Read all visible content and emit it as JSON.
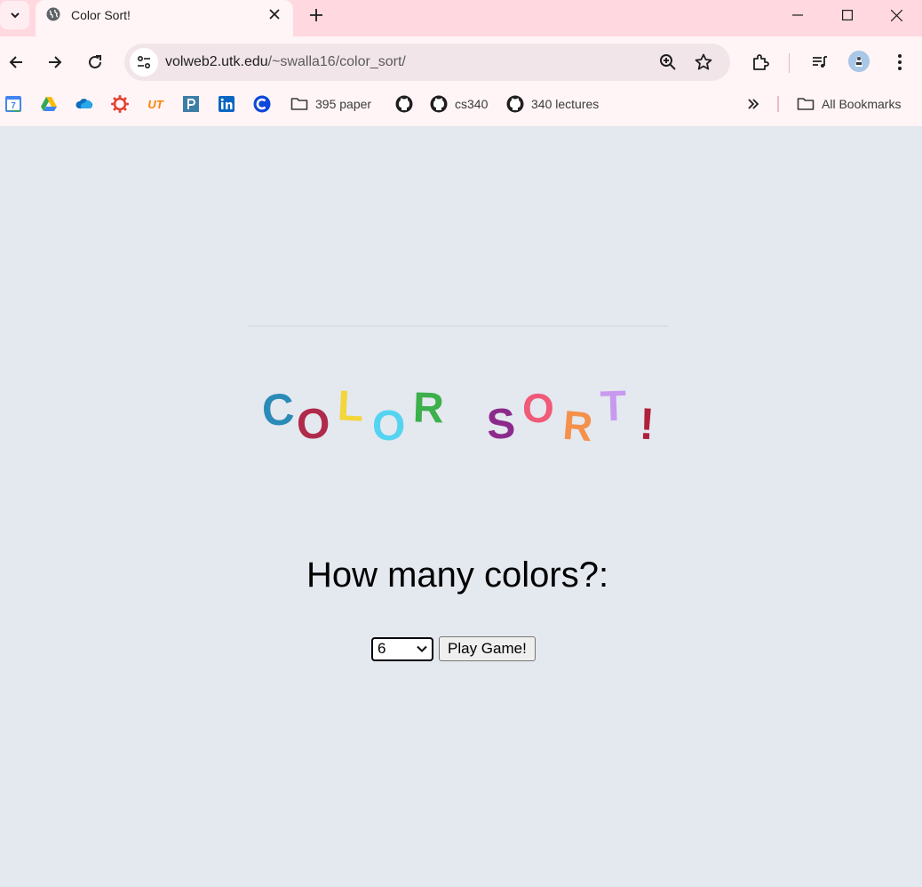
{
  "browser": {
    "tab_title": "Color Sort!",
    "url_host": "volweb2.utk.edu",
    "url_path": "/~swalla16/color_sort/"
  },
  "bookmarks": [
    {
      "label": "",
      "icon": "calendar-icon"
    },
    {
      "label": "",
      "icon": "drive-icon"
    },
    {
      "label": "",
      "icon": "onedrive-icon"
    },
    {
      "label": "",
      "icon": "canvas-icon"
    },
    {
      "label": "",
      "icon": "ut-icon"
    },
    {
      "label": "",
      "icon": "p-icon"
    },
    {
      "label": "",
      "icon": "linkedin-icon"
    },
    {
      "label": "",
      "icon": "c-icon"
    },
    {
      "label": "395 paper",
      "icon": "folder-icon"
    },
    {
      "label": "",
      "icon": "github-icon"
    },
    {
      "label": "cs340",
      "icon": "github-icon"
    },
    {
      "label": "340 lectures",
      "icon": "github-icon"
    }
  ],
  "all_bookmarks_label": "All Bookmarks",
  "logo": {
    "letters": [
      "C",
      "O",
      "L",
      "O",
      "R",
      "S",
      "O",
      "R",
      "T",
      "!"
    ],
    "colors": [
      "#2a8ab8",
      "#b02a4a",
      "#f2d63a",
      "#55d4f2",
      "#3cb04a",
      "#8c2a8c",
      "#f05a78",
      "#f5914a",
      "#c79af0",
      "#b0203a"
    ]
  },
  "question": "How many colors?:",
  "color_select": {
    "selected": "6"
  },
  "play_button_label": "Play Game!",
  "colors": {
    "tab_strip": "#ffd8e0",
    "toolbar": "#fff4f6",
    "page_bg": "#e4e8ef"
  }
}
